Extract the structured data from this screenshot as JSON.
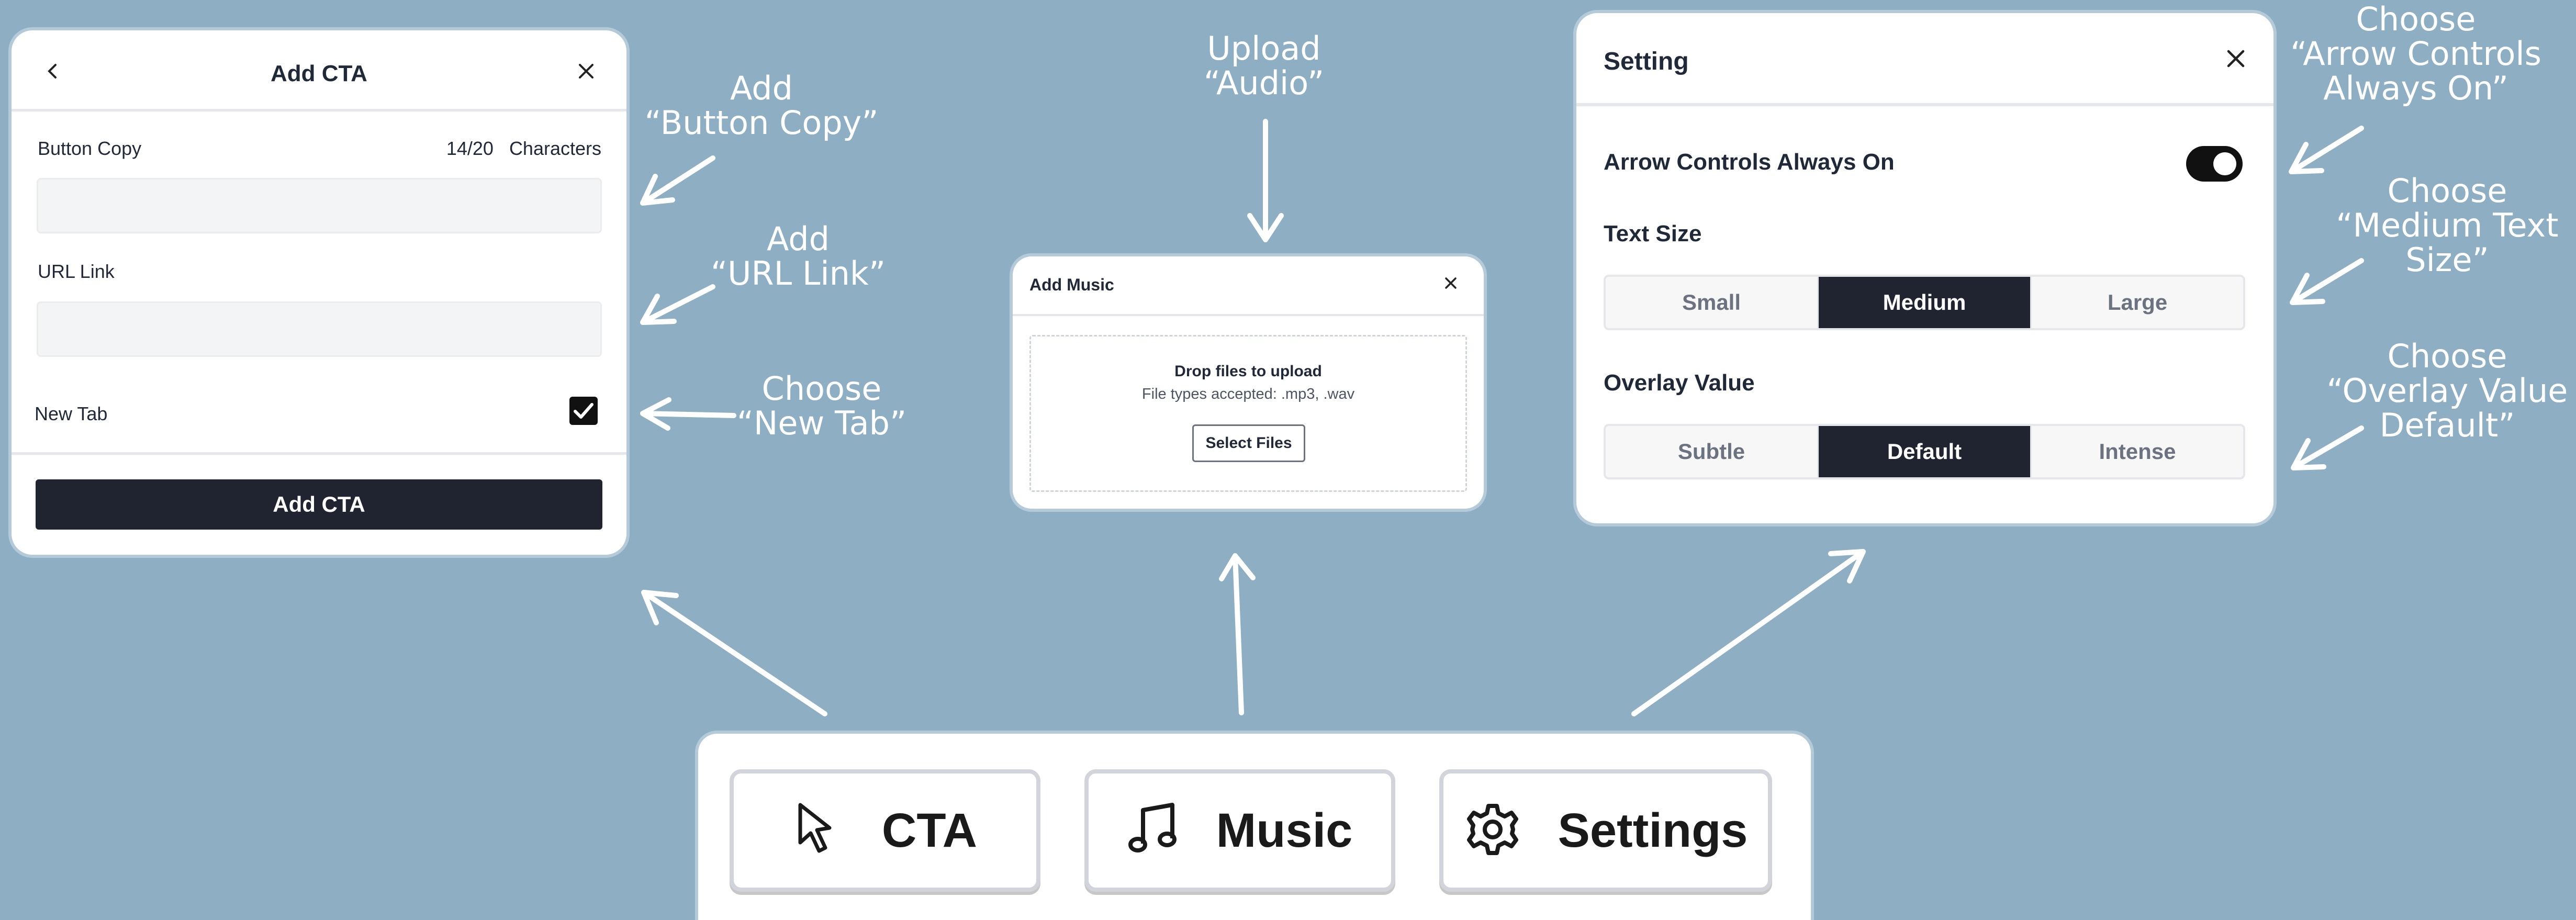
{
  "cta_panel": {
    "title": "Add CTA",
    "button_copy_label": "Button Copy",
    "char_count": "14/20",
    "char_unit": "Characters",
    "url_label": "URL Link",
    "new_tab_label": "New Tab",
    "new_tab_checked": true,
    "submit_label": "Add CTA"
  },
  "music_panel": {
    "title": "Add Music",
    "drop_title": "Drop files to upload",
    "drop_types": "File types accepted: .mp3, .wav",
    "select_label": "Select Files"
  },
  "settings_panel": {
    "title": "Setting",
    "arrow_controls_label": "Arrow Controls Always On",
    "arrow_controls_on": true,
    "text_size_label": "Text Size",
    "text_size_options": [
      "Small",
      "Medium",
      "Large"
    ],
    "text_size_selected": "Medium",
    "overlay_label": "Overlay Value",
    "overlay_options": [
      "Subtle",
      "Default",
      "Intense"
    ],
    "overlay_selected": "Default"
  },
  "toolbar": {
    "cta_label": "CTA",
    "music_label": "Music",
    "settings_label": "Settings"
  },
  "callouts": {
    "add_button_copy": [
      "Add",
      "“Button Copy”"
    ],
    "add_url_link": [
      "Add",
      "“URL Link”"
    ],
    "choose_new_tab": [
      "Choose",
      "“New Tab”"
    ],
    "upload_audio": [
      "Upload",
      "“Audio”"
    ],
    "choose_arrow_controls": [
      "Choose",
      "“Arrow Controls",
      "Always On”"
    ],
    "choose_medium": [
      "Choose",
      "“Medium Text",
      "Size”"
    ],
    "choose_overlay": [
      "Choose",
      "“Overlay Value",
      "Default”"
    ]
  },
  "colors": {
    "background": "#8daec3",
    "dark": "#1f2430",
    "annotation": "#ffffff"
  }
}
